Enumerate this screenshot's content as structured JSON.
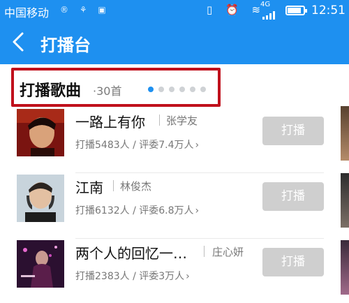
{
  "status_bar": {
    "carrier": "中国移动",
    "network": "4G",
    "time": "12:51",
    "battery_level": 0.85
  },
  "nav": {
    "title": "打播台",
    "back_icon": "chevron-left-icon"
  },
  "section": {
    "title": "打播歌曲",
    "count": "·30首",
    "pages": 6,
    "active_page": 1
  },
  "songs": [
    {
      "name": "一路上有你",
      "artist": "张学友",
      "stats": "打播5483人 / 评委7.4万人",
      "button": "打播"
    },
    {
      "name": "江南",
      "artist": "林俊杰",
      "stats": "打播6132人 / 评委6.8万人",
      "button": "打播"
    },
    {
      "name": "两个人的回忆一…",
      "artist": "庄心妍",
      "stats": "打播2383人 / 评委3万人",
      "button": "打播"
    }
  ],
  "colors": {
    "brand": "#1e90f0",
    "highlight_box": "#c0101c",
    "button_bg": "#cfcfcf"
  }
}
